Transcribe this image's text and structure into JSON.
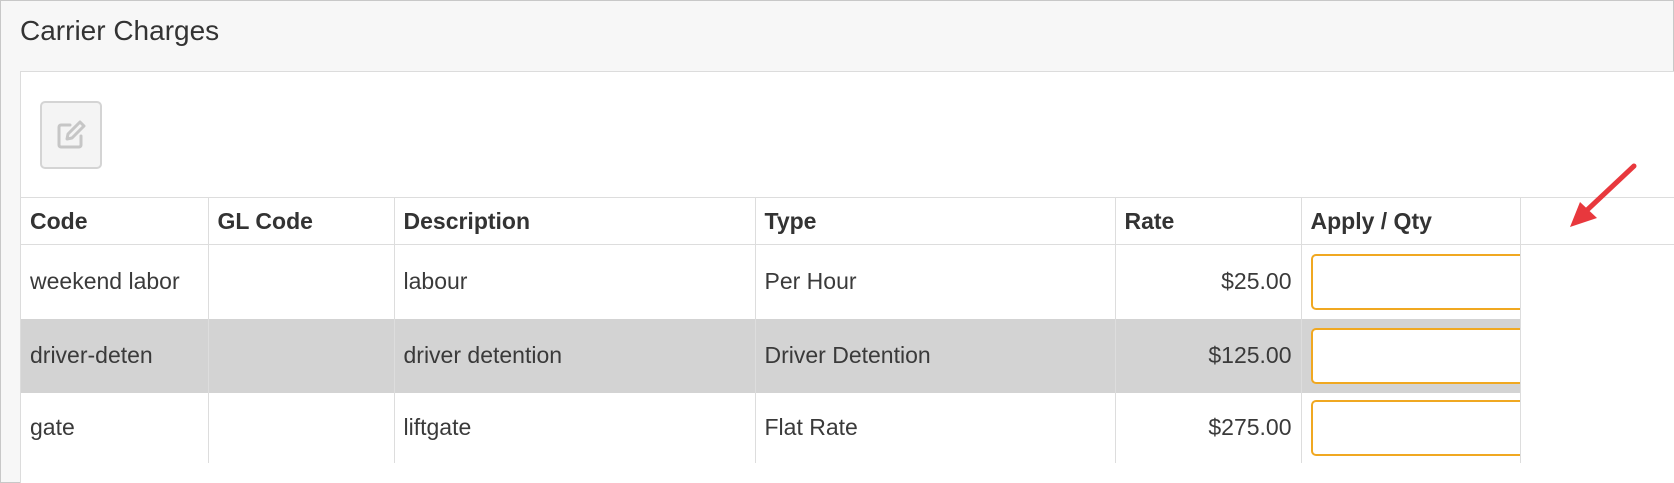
{
  "panel": {
    "title": "Carrier Charges"
  },
  "toolbar": {
    "edit_icon": "edit-icon"
  },
  "table": {
    "columns": [
      "Code",
      "GL Code",
      "Description",
      "Type",
      "Rate",
      "Apply / Qty"
    ],
    "rows": [
      {
        "code": "weekend labor",
        "gl_code": "",
        "description": "labour",
        "type": "Per Hour",
        "rate": "$25.00",
        "qty": ""
      },
      {
        "code": "driver-deten",
        "gl_code": "",
        "description": "driver detention",
        "type": "Driver Detention",
        "rate": "$125.00",
        "qty": "",
        "selected": true
      },
      {
        "code": "gate",
        "gl_code": "",
        "description": "liftgate",
        "type": "Flat Rate",
        "rate": "$275.00",
        "qty": ""
      }
    ]
  },
  "colors": {
    "selected_row": "#d3d3d3",
    "input_border": "#f0a821",
    "arrow": "#e8383d"
  },
  "annotation": {
    "icon": "red-arrow-icon"
  }
}
